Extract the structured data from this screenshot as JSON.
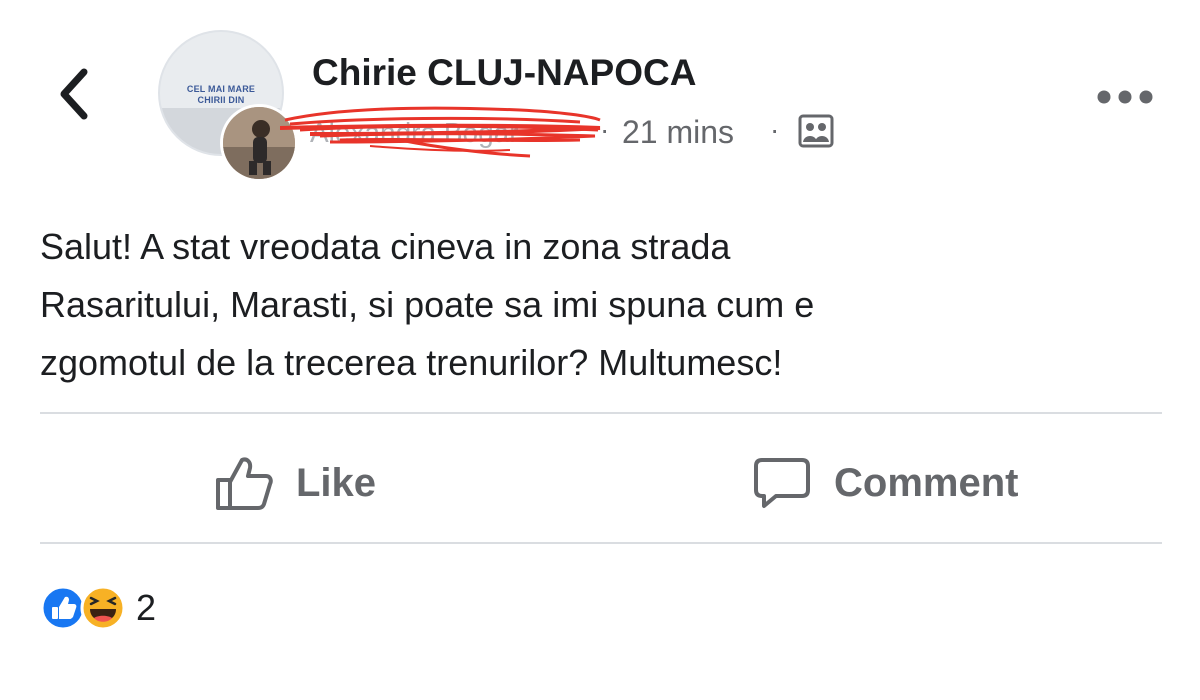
{
  "post": {
    "group_avatar": {
      "line1": "CEL MAI MARE",
      "line2": "CHIRII DIN"
    },
    "group_name": "Chirie CLUJ-NAPOCA",
    "author_name": "Alexandra Bogar",
    "time": "21 mins",
    "separator": "·",
    "audience_icon": "group-icon",
    "text": "Salut! A stat vreodata cineva in zona strada\nRasaritului, Marasti, si poate sa imi spuna cum e\nzgomotul de la trecerea trenurilor? Multumesc!",
    "actions": {
      "like_label": "Like",
      "comment_label": "Comment"
    },
    "reactions": {
      "count": "2",
      "types": [
        "like",
        "haha"
      ]
    }
  },
  "colors": {
    "like_blue": "#1877f2",
    "haha_yellow": "#f7b125",
    "redaction_red": "#e8342a",
    "secondary_text": "#65676b"
  }
}
